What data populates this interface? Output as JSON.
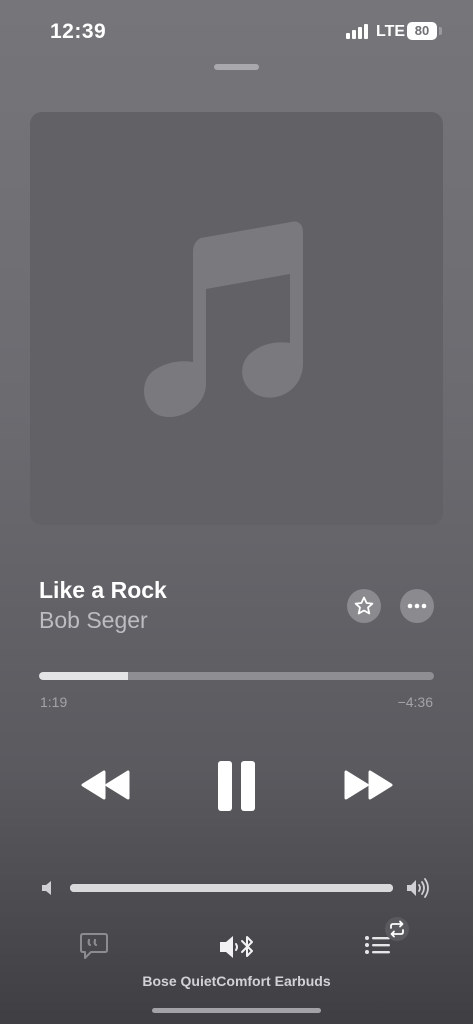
{
  "status_bar": {
    "time": "12:39",
    "network": "LTE",
    "battery": "80",
    "icons": [
      "signal-icon",
      "battery-icon"
    ]
  },
  "artwork": {
    "icon": "music-note-icon",
    "colors": {
      "background": "#616166",
      "glyph": "#7a7a7f"
    }
  },
  "track": {
    "title": "Like a Rock",
    "artist": "Bob Seger"
  },
  "actions": {
    "icons": [
      "star-icon",
      "more-icon"
    ]
  },
  "playback": {
    "elapsed": "1:19",
    "remaining": "−4:36",
    "progress_fraction": 0.225,
    "state": "playing",
    "icons": [
      "rewind-icon",
      "pause-icon",
      "fast-forward-icon"
    ]
  },
  "volume": {
    "level_fraction": 1.0,
    "icons": [
      "volume-low-icon",
      "volume-high-icon"
    ]
  },
  "bottom_bar": {
    "device_name": "Bose QuietComfort Earbuds",
    "icons": [
      "lyrics-icon",
      "bluetooth-speaker-icon",
      "queue-icon",
      "repeat-icon"
    ]
  },
  "colors": {
    "background_top": "#76767a",
    "background_bottom": "#3f3f43",
    "progress_fill": "#e4e4e7",
    "progress_track": "#8e8e93",
    "secondary_text": "#bdbdc1"
  }
}
